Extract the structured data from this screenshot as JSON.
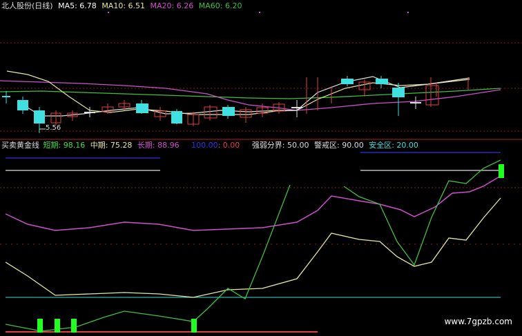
{
  "price_legend": {
    "title": "北人股份(日线)",
    "ma5": "MA5: 6.78",
    "ma10": "MA10: 6.51",
    "ma20": "MA20: 6.26",
    "ma60": "MA60: 6.20"
  },
  "indicator_legend": {
    "name": "买卖黄金线",
    "short": "短期: 98.16",
    "mid": "中期: 75.28",
    "long": "长期: 88.96",
    "val100": "100.00",
    "val0": ": 0.00",
    "divide": "强弱分界: 50.00",
    "warn": "警戒区: 90.00",
    "safe": "安全区: 20.00"
  },
  "low_price_label": "5.56",
  "watermark": "www.7gpzb.com",
  "colors": {
    "white_line": "#e0e0e0",
    "yellow_line": "#e8e8a0",
    "magenta": "#d050d0",
    "green": "#40c040",
    "cyan": "#40e0e0",
    "red": "#e04040",
    "blue": "#3030e0",
    "bright_green_bar": "#20ff20",
    "grid_red": "#8b1a1a",
    "teal_line": "#30b0b0"
  }
}
